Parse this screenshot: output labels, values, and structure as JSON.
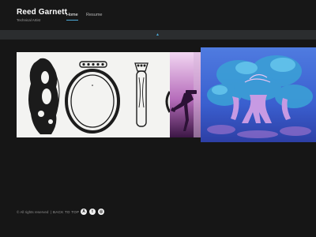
{
  "header": {
    "name": "Reed Garnett",
    "tagline": "Technical Artist",
    "nav": [
      {
        "label": "Home",
        "active": true
      },
      {
        "label": "Resume",
        "active": false
      }
    ]
  },
  "subbar": {
    "icon": "chevron-up-icon",
    "glyph": "▲"
  },
  "gallery": [
    {
      "subject": "ornate ring sketch",
      "colors": [
        "#f2f2f2",
        "#1c1c1c"
      ]
    },
    {
      "subject": "figure on stool in purple light",
      "colors": [
        "#e8c6ea",
        "#4a1f52"
      ]
    },
    {
      "subject": "stylized blue tree",
      "colors": [
        "#3c63c8",
        "#c49ae0"
      ]
    }
  ],
  "footer": {
    "copyright": "© All rights reserved",
    "separator": "|",
    "back_to_top": "BACK TO TOP",
    "back_to_top_icon": "↑",
    "socials": [
      {
        "name": "artstation-icon",
        "glyph": "A"
      },
      {
        "name": "twitter-icon",
        "glyph": "t"
      },
      {
        "name": "instagram-icon",
        "glyph": "◎"
      }
    ]
  },
  "colors": {
    "background": "#161616",
    "accent": "#4ba8d6",
    "subbar": "#2b2d2f"
  }
}
